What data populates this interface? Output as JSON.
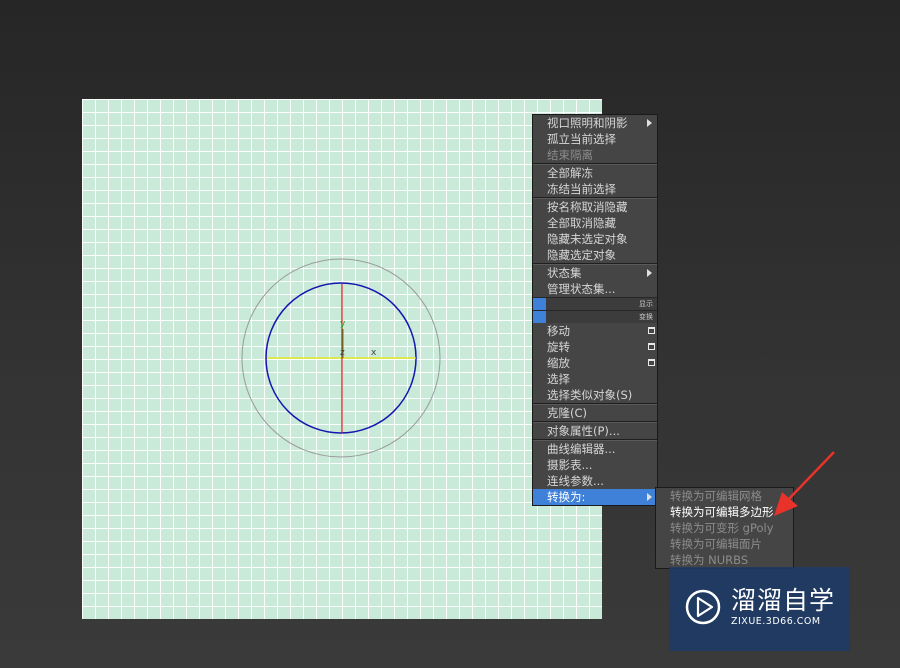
{
  "quad_menu": {
    "groups": [
      [
        {
          "label": "视口照明和阴影",
          "arrow": true
        },
        {
          "label": "孤立当前选择"
        },
        {
          "label": "结束隔离",
          "dim": true
        }
      ],
      [
        {
          "label": "全部解冻"
        },
        {
          "label": "冻结当前选择"
        }
      ],
      [
        {
          "label": "按名称取消隐藏"
        },
        {
          "label": "全部取消隐藏"
        },
        {
          "label": "隐藏未选定对象"
        },
        {
          "label": "隐藏选定对象"
        }
      ],
      [
        {
          "label": "状态集",
          "arrow": true
        },
        {
          "label": "管理状态集..."
        }
      ]
    ],
    "display_header": "显示",
    "transform_header": "变换",
    "transform_items": [
      {
        "label": "移动",
        "option": true
      },
      {
        "label": "旋转",
        "option": true
      },
      {
        "label": "缩放",
        "option": true
      },
      {
        "label": "选择"
      },
      {
        "label": "选择类似对象(S)"
      }
    ],
    "clone": "克隆(C)",
    "object_properties": "对象属性(P)...",
    "curve_editor": "曲线编辑器...",
    "dope_sheet": "摄影表...",
    "wire_parameters": "连线参数...",
    "convert_to": "转换为:"
  },
  "submenu": {
    "items": [
      {
        "label": "转换为可编辑网格"
      },
      {
        "label": "转换为可编辑多边形",
        "highlight": true
      },
      {
        "label": "转换为可变形 gPoly"
      },
      {
        "label": "转换为可编辑面片"
      },
      {
        "label": "转换为 NURBS"
      }
    ]
  },
  "gizmo": {
    "x": "x",
    "y": "y",
    "z": "z"
  },
  "colors": {
    "viewport_bg": "#c9e9d9",
    "grid": "#ffffff",
    "menu_bg": "#454545",
    "highlight": "#3f80d8",
    "circle": "#1515b0",
    "pointer": "#e8322a",
    "watermark_bg": "#1c3a68"
  },
  "watermark": {
    "name": "溜溜自学",
    "url": "ZIXUE.3D66.COM",
    "icon": "play-logo-icon"
  }
}
